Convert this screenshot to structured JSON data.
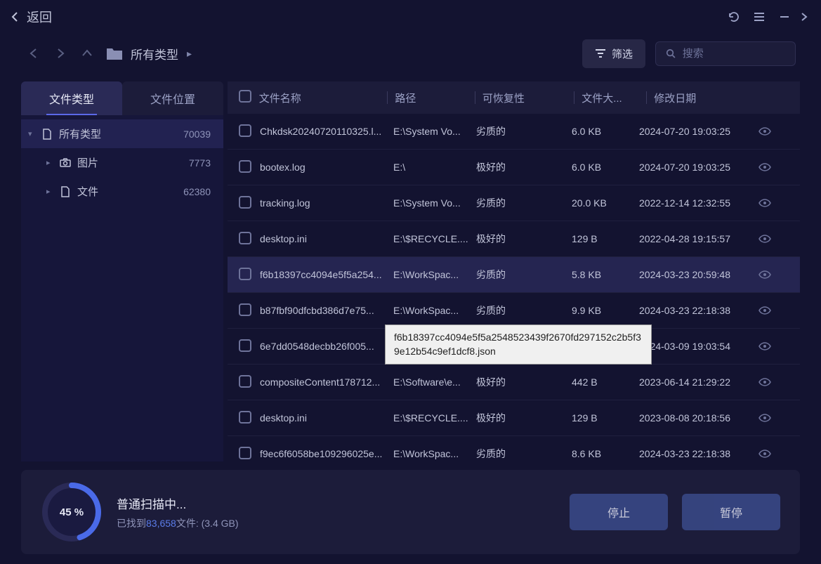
{
  "titlebar": {
    "back": "返回"
  },
  "nav": {
    "breadcrumb": "所有类型",
    "filter_label": "筛选",
    "search_placeholder": "搜索"
  },
  "sidebar": {
    "tabs": [
      {
        "label": "文件类型",
        "active": true
      },
      {
        "label": "文件位置",
        "active": false
      }
    ],
    "tree": [
      {
        "icon": "file",
        "label": "所有类型",
        "count": "70039",
        "level": 1,
        "active": true,
        "caret": "▾"
      },
      {
        "icon": "camera",
        "label": "图片",
        "count": "7773",
        "level": 2,
        "caret": "▸"
      },
      {
        "icon": "doc",
        "label": "文件",
        "count": "62380",
        "level": 2,
        "caret": "▸"
      }
    ]
  },
  "table": {
    "headers": {
      "name": "文件名称",
      "path": "路径",
      "recover": "可恢复性",
      "size": "文件大...",
      "date": "修改日期"
    },
    "rows": [
      {
        "name": "Chkdsk20240720110325.l...",
        "path": "E:\\System Vo...",
        "rec": "劣质的",
        "size": "6.0 KB",
        "date": "2024-07-20 19:03:25"
      },
      {
        "name": "bootex.log",
        "path": "E:\\",
        "rec": "极好的",
        "size": "6.0 KB",
        "date": "2024-07-20 19:03:25"
      },
      {
        "name": "tracking.log",
        "path": "E:\\System Vo...",
        "rec": "劣质的",
        "size": "20.0 KB",
        "date": "2022-12-14 12:32:55"
      },
      {
        "name": "desktop.ini",
        "path": "E:\\$RECYCLE....",
        "rec": "极好的",
        "size": "129 B",
        "date": "2022-04-28 19:15:57"
      },
      {
        "name": "f6b18397cc4094e5f5a254...",
        "path": "E:\\WorkSpac...",
        "rec": "劣质的",
        "size": "5.8 KB",
        "date": "2024-03-23 20:59:48",
        "hover": true
      },
      {
        "name": "b87fbf90dfcbd386d7e75...",
        "path": "E:\\WorkSpac...",
        "rec": "劣质的",
        "size": "9.9 KB",
        "date": "2024-03-23 22:18:38"
      },
      {
        "name": "6e7dd0548decbb26f005...",
        "path": "",
        "rec": "",
        "size": "",
        "date": "2024-03-09 19:03:54"
      },
      {
        "name": "compositeContent178712...",
        "path": "E:\\Software\\e...",
        "rec": "极好的",
        "size": "442 B",
        "date": "2023-06-14 21:29:22"
      },
      {
        "name": "desktop.ini",
        "path": "E:\\$RECYCLE....",
        "rec": "极好的",
        "size": "129 B",
        "date": "2023-08-08 20:18:56"
      },
      {
        "name": "f9ec6f6058be109296025e...",
        "path": "E:\\WorkSpac...",
        "rec": "劣质的",
        "size": "8.6 KB",
        "date": "2024-03-23 22:18:38"
      }
    ]
  },
  "tooltip": "f6b18397cc4094e5f5a2548523439f2670fd297152c2b5f39e12b54c9ef1dcf8.json",
  "footer": {
    "percent": "45 %",
    "percent_num": 45,
    "title": "普通扫描中...",
    "found_prefix": "已找到",
    "found_count": "83,658",
    "found_suffix": "文件: (3.4 GB)",
    "stop": "停止",
    "pause": "暂停"
  }
}
